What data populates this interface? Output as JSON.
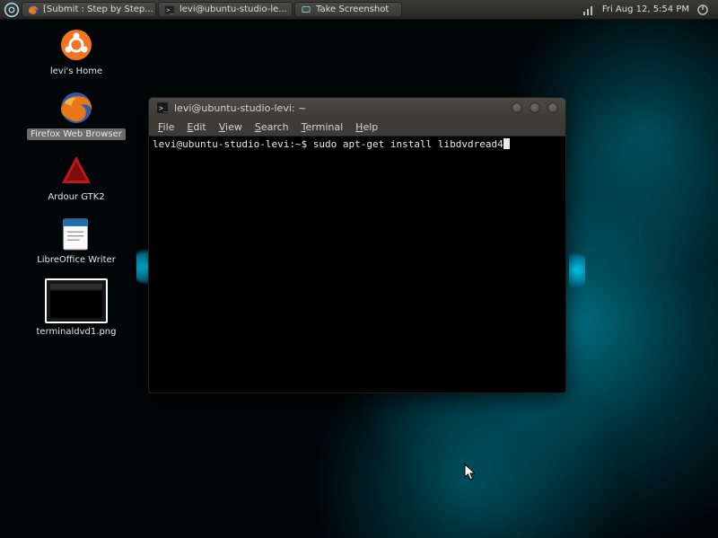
{
  "panel": {
    "tasks": [
      {
        "label": "[Submit : Step by Step..."
      },
      {
        "label": "levi@ubuntu-studio-le..."
      },
      {
        "label": "Take Screenshot"
      }
    ],
    "clock": "Fri Aug 12,  5:54 PM"
  },
  "desktop": {
    "icons": [
      {
        "name": "home",
        "label": "levi's Home"
      },
      {
        "name": "firefox",
        "label": "Firefox Web Browser",
        "selected": true
      },
      {
        "name": "ardour",
        "label": "Ardour GTK2"
      },
      {
        "name": "writer",
        "label": "LibreOffice Writer"
      },
      {
        "name": "shot",
        "label": "terminaldvd1.png"
      }
    ]
  },
  "terminal": {
    "title": "levi@ubuntu-studio-levi: ~",
    "menus": [
      "File",
      "Edit",
      "View",
      "Search",
      "Terminal",
      "Help"
    ],
    "prompt": "levi@ubuntu-studio-levi:~$ ",
    "command": "sudo apt-get install libdvdread4"
  },
  "colors": {
    "panel_bg": "#2f2f2d",
    "window_chrome": "#3c3b37",
    "terminal_bg": "#000000",
    "terminal_fg": "#eaeaea",
    "accent_cyan": "#00e0ff"
  }
}
